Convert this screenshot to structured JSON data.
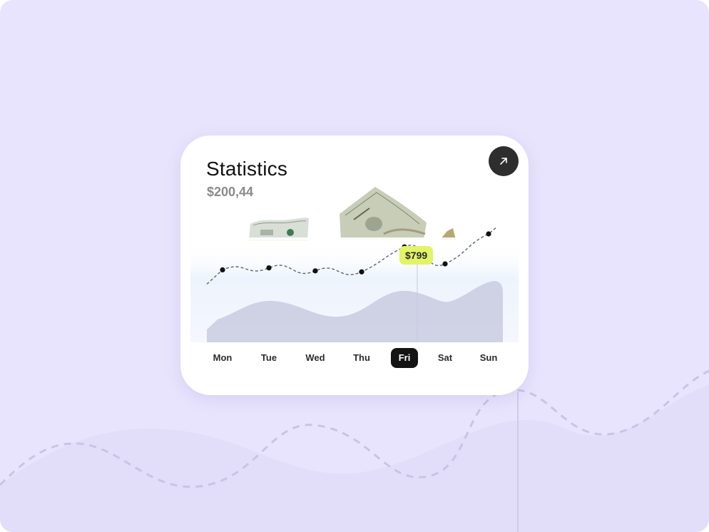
{
  "card": {
    "title": "Statistics",
    "amount": "$200,44",
    "open_icon": "arrow-up-right-icon"
  },
  "tooltip": {
    "value": "$799"
  },
  "days": [
    "Mon",
    "Tue",
    "Wed",
    "Thu",
    "Fri",
    "Sat",
    "Sun"
  ],
  "active_day": "Fri",
  "colors": {
    "background": "#e8e4fd",
    "card": "#ffffff",
    "accent_tag": "#e2f466",
    "active_day": "#141414",
    "area": "#c9cbe0",
    "line": "#5b5f85"
  },
  "chart_data": {
    "type": "line",
    "categories": [
      "Mon",
      "Tue",
      "Wed",
      "Thu",
      "Fri",
      "Sat",
      "Sun"
    ],
    "series": [
      {
        "values": [
          440,
          460,
          430,
          420,
          670,
          500,
          800
        ]
      }
    ],
    "highlight": {
      "category": "Fri",
      "label": "$799"
    },
    "ylim": [
      0,
      1000
    ],
    "grid": false
  }
}
